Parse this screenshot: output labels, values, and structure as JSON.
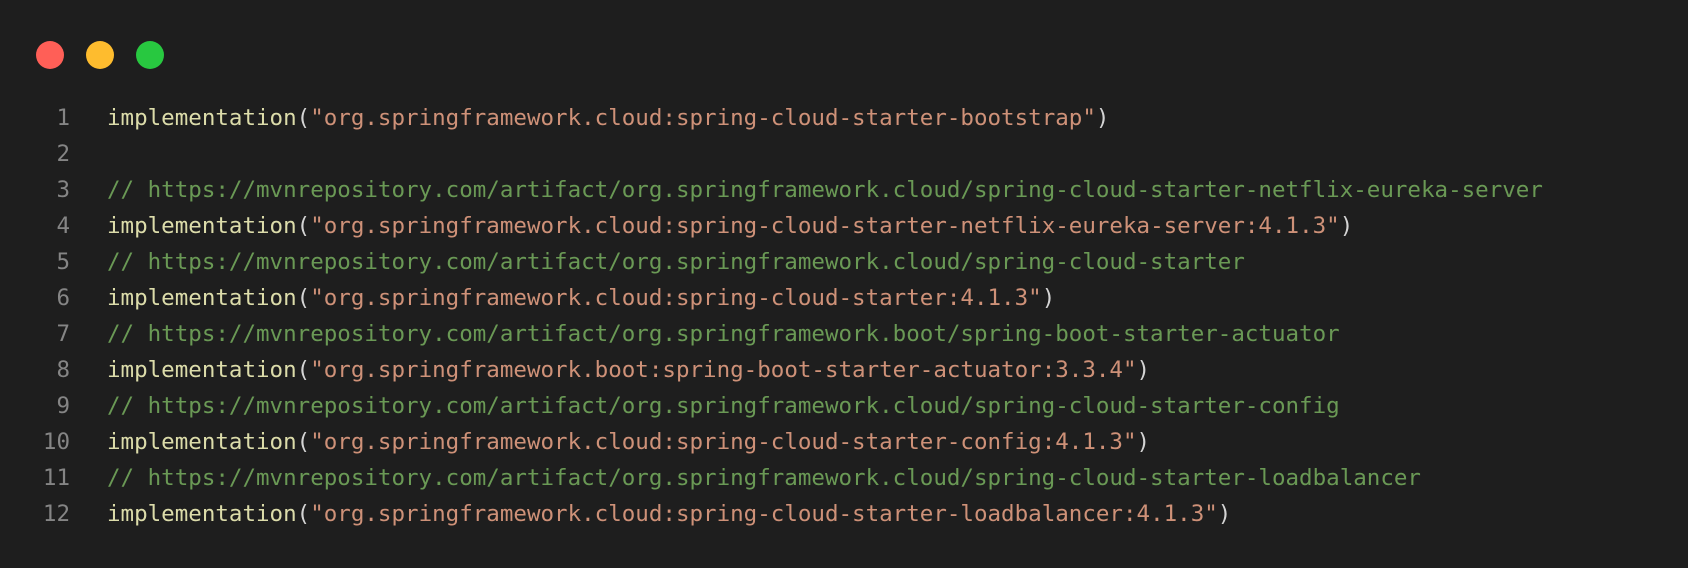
{
  "window": {
    "traffic_lights": [
      "close",
      "minimize",
      "zoom"
    ],
    "colors": {
      "background": "#1e1e1e",
      "close": "#ff5f57",
      "minimize": "#febc2e",
      "zoom": "#28c840",
      "function": "#dcdcaa",
      "string": "#ce9178",
      "comment": "#6a9955",
      "line_number": "#858585"
    }
  },
  "code": {
    "lines": [
      {
        "num": "1",
        "kind": "impl",
        "fn": "implementation",
        "open": "(",
        "str": "\"org.springframework.cloud:spring-cloud-starter-bootstrap\"",
        "close": ")"
      },
      {
        "num": "2",
        "kind": "blank"
      },
      {
        "num": "3",
        "kind": "comment",
        "text": "// https://mvnrepository.com/artifact/org.springframework.cloud/spring-cloud-starter-netflix-eureka-server"
      },
      {
        "num": "4",
        "kind": "impl",
        "fn": "implementation",
        "open": "(",
        "str": "\"org.springframework.cloud:spring-cloud-starter-netflix-eureka-server:4.1.3\"",
        "close": ")"
      },
      {
        "num": "5",
        "kind": "comment",
        "text": "// https://mvnrepository.com/artifact/org.springframework.cloud/spring-cloud-starter"
      },
      {
        "num": "6",
        "kind": "impl",
        "fn": "implementation",
        "open": "(",
        "str": "\"org.springframework.cloud:spring-cloud-starter:4.1.3\"",
        "close": ")"
      },
      {
        "num": "7",
        "kind": "comment",
        "text": "// https://mvnrepository.com/artifact/org.springframework.boot/spring-boot-starter-actuator"
      },
      {
        "num": "8",
        "kind": "impl",
        "fn": "implementation",
        "open": "(",
        "str": "\"org.springframework.boot:spring-boot-starter-actuator:3.3.4\"",
        "close": ")"
      },
      {
        "num": "9",
        "kind": "comment",
        "text": "// https://mvnrepository.com/artifact/org.springframework.cloud/spring-cloud-starter-config"
      },
      {
        "num": "10",
        "kind": "impl",
        "fn": "implementation",
        "open": "(",
        "str": "\"org.springframework.cloud:spring-cloud-starter-config:4.1.3\"",
        "close": ")"
      },
      {
        "num": "11",
        "kind": "comment",
        "text": "// https://mvnrepository.com/artifact/org.springframework.cloud/spring-cloud-starter-loadbalancer"
      },
      {
        "num": "12",
        "kind": "impl",
        "fn": "implementation",
        "open": "(",
        "str": "\"org.springframework.cloud:spring-cloud-starter-loadbalancer:4.1.3\"",
        "close": ")"
      }
    ]
  }
}
